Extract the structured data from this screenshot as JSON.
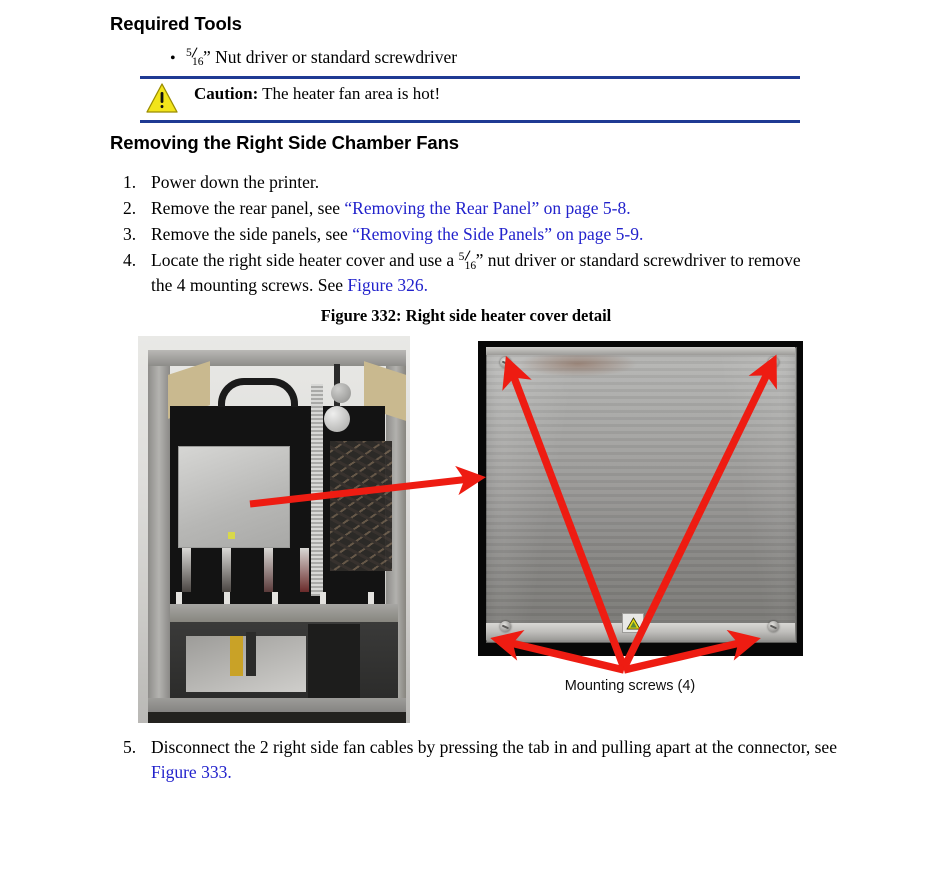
{
  "document": {
    "sections": [
      {
        "id": "required-tools",
        "heading": "Required Tools"
      },
      {
        "id": "removing-fans",
        "heading": "Removing the Right Side Chamber Fans"
      }
    ],
    "tools_bullet": {
      "fraction_numerator": "5",
      "fraction_denominator": "16",
      "text": "” Nut driver or standard screwdriver"
    },
    "caution": {
      "icon": "warning-triangle-icon",
      "label": "Caution:",
      "text": " The heater fan area is hot!",
      "rule_color": "#1f3a93",
      "icon_color": "#f2e41b"
    },
    "steps": [
      {
        "num": "1.",
        "parts": [
          {
            "t": "Power down the printer.",
            "link": false
          }
        ]
      },
      {
        "num": "2.",
        "parts": [
          {
            "t": "Remove the rear panel, see ",
            "link": false
          },
          {
            "t": "“Removing the Rear Panel” on page 5-8.",
            "link": true
          }
        ]
      },
      {
        "num": "3.",
        "parts": [
          {
            "t": "Remove the side panels, see ",
            "link": false
          },
          {
            "t": "“Removing the Side Panels” on page 5-9.",
            "link": true
          }
        ]
      },
      {
        "num": "4.",
        "parts": [
          {
            "t": "Locate the right side heater cover and use a ",
            "link": false
          },
          {
            "t": "FRACTION",
            "link": false
          },
          {
            "t": "” nut driver or standard screwdriver to remove the 4 mounting screws. See ",
            "link": false
          },
          {
            "t": "Figure 326.",
            "link": true
          }
        ]
      }
    ],
    "step5": {
      "num": "5.",
      "parts": [
        {
          "t": "Disconnect the 2 right side fan cables by pressing the tab in and pulling apart at the connector, see ",
          "link": false
        },
        {
          "t": "Figure 333.",
          "link": true
        }
      ]
    },
    "figure": {
      "caption": "Figure 332: Right side heater cover detail",
      "left_photo_alt": "printer rear interior with right side heater cover",
      "right_photo_alt": "right side heater cover close-up with four mounting screws",
      "callout": "Mounting screws (4)",
      "arrow_color": "#ee1c12",
      "screw_count": 4
    },
    "link_color": "#2222cc"
  }
}
